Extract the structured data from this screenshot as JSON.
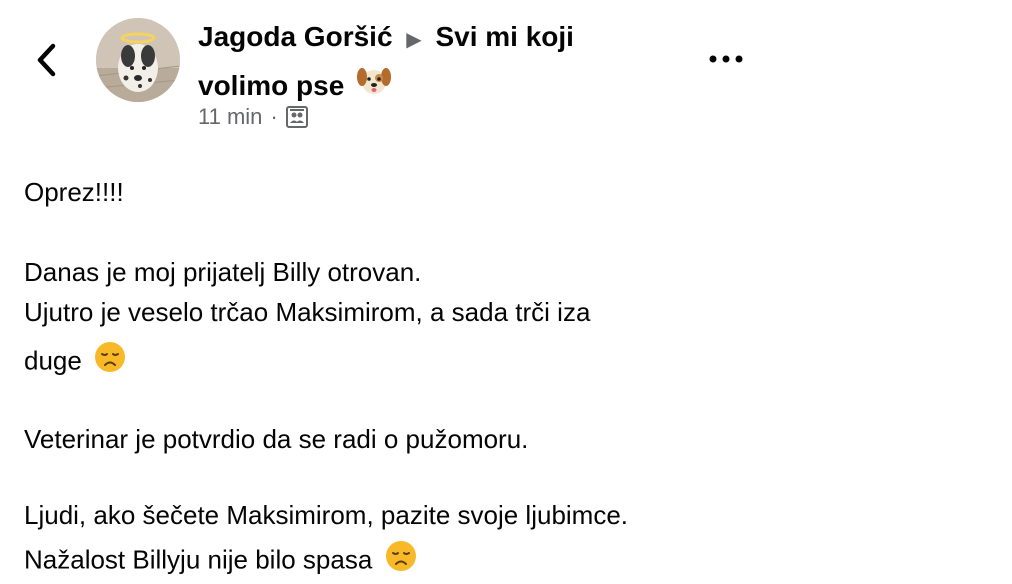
{
  "header": {
    "author": "Jagoda Goršić",
    "separator": "▶",
    "group": "Svi mi koji volimo pse",
    "time": "11 min",
    "dot": "·"
  },
  "icons": {
    "back": "chevron-left-icon",
    "more": "more-horizontal-icon",
    "audience": "group-audience-icon",
    "dog_emoji": "dog-face-emoji",
    "sad_emoji": "disappointed-face-emoji"
  },
  "post": {
    "line1": "Oprez!!!!",
    "line2": "Danas je moj prijatelj Billy otrovan.",
    "line3": "Ujutro je veselo trčao Maksimirom, a sada trči iza",
    "line4": "duge",
    "line5": "Veterinar je potvrdio da se radi o pužomoru.",
    "line6": "Ljudi, ako šečete Maksimirom, pazite svoje ljubimce.",
    "line7": "Nažalost Billyju nije bilo spasa"
  },
  "colors": {
    "text": "#050505",
    "secondary": "#65676b",
    "emoji_yellow": "#f7b928"
  }
}
